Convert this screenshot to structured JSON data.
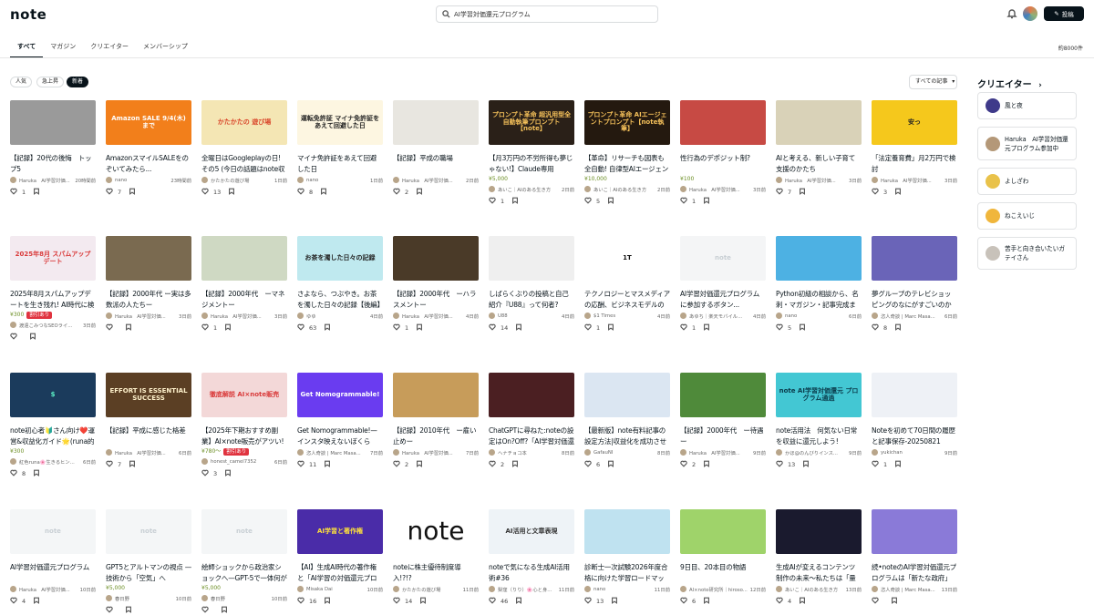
{
  "header": {
    "logo": "note",
    "search_value": "AI学習対価還元プログラム",
    "post_label": "投稿"
  },
  "tabs": [
    "すべて",
    "マガジン",
    "クリエイター",
    "メンバーシップ"
  ],
  "result_count": "約8000件",
  "filters": [
    "人気",
    "急上昇",
    "新着"
  ],
  "sort_label": "すべての記事",
  "sidebar": {
    "title": "クリエイター",
    "creators": [
      "風と夜",
      "Haruka　AI学習対価還元プログラム参加中",
      "よしざわ",
      "ねこえいじ",
      "苦手と向き合いたいガテイさん"
    ]
  },
  "cards": [
    {
      "thumb": "",
      "title": "【記録】20代の後悔　トップ5",
      "author": "Haruka　AI学習対価...",
      "time": "20時間前",
      "likes": "1"
    },
    {
      "thumb": "Amazon SALE 9/4(木)まで",
      "title": "AmazonスマイルSALEをのぞいてみたら...",
      "author": "nano",
      "time": "23時間前",
      "likes": "7"
    },
    {
      "thumb": "かたかたの 遊び場",
      "title": "全曜日はGoogleplayの日! その5 (今日の話題はnote収益化!)",
      "author": "かたかたの遊び場",
      "time": "1日前",
      "likes": "13"
    },
    {
      "thumb": "運転免許証 マイナ免許証を あえて回避した日",
      "title": "マイナ免許証をあえて回避した日",
      "author": "nano",
      "time": "1日前",
      "likes": "8"
    },
    {
      "thumb": "",
      "title": "【記録】平成の職場",
      "author": "Haruka　AI学習対価...",
      "time": "2日前",
      "likes": "2"
    },
    {
      "thumb": "プロンプト革命 超汎用型全自動執筆プロンプト【note】",
      "title": "【月3万円の不労所得も夢じゃない!】Claude専用(ChatGPTも対応)・NOTE...",
      "price": "¥5,000",
      "author": "あいこ｜AIのある生き方",
      "time": "2日前",
      "likes": "1"
    },
    {
      "thumb": "プロンプト革命 AIエージェントプロンプト【note執筆】",
      "title": "【革命】リサーチも図表も全自動! 自律型AIエージェントが30分で「月◯円稼ぐ...",
      "price": "¥10,000",
      "author": "あいこ｜AIのある生き方",
      "time": "2日前",
      "likes": "5"
    },
    {
      "thumb": "",
      "title": "性行為のデポジット制?",
      "price": "¥100",
      "author": "Haruka　AI学習対価...",
      "time": "3日前",
      "likes": "1"
    },
    {
      "thumb": "",
      "title": "AIと考える、新しい子育て支援のかたち",
      "author": "Haruka　AI学習対価...",
      "time": "3日前",
      "likes": "7"
    },
    {
      "thumb": "安っ",
      "title": "「法定養育費」月2万円で検討",
      "author": "Haruka　AI学習対価...",
      "time": "3日前",
      "likes": "3"
    },
    {
      "thumb": "2025年8月 スパムアップデート",
      "title": "2025年8月スパムアップデートを生き残れ! AI時代に検索上位になるnoteの条...",
      "price": "¥300",
      "badge": "割引あり",
      "author": "渡遠こみつなSEOライ...",
      "time": "3日前",
      "likes": ""
    },
    {
      "thumb": "",
      "title": "【記録】2000年代 ー実は多数派の人たちー",
      "author": "Haruka　AI学習対価...",
      "time": "3日前",
      "likes": ""
    },
    {
      "thumb": "",
      "title": "【記録】2000年代　ーマネジメントー",
      "author": "Haruka　AI学習対価...",
      "time": "3日前",
      "likes": "1"
    },
    {
      "thumb": "お茶を濁した日々の記録",
      "title": "さよなら、つぶやき。お茶を濁した日々の記録【後編】",
      "author": "ゆゆ",
      "time": "4日前",
      "likes": "63"
    },
    {
      "thumb": "",
      "title": "【記録】2000年代　ーハラスメントー",
      "author": "Haruka　AI学習対価...",
      "time": "4日前",
      "likes": "1"
    },
    {
      "thumb": "",
      "title": "しばらくぶりの投稿と自己紹介『U88』って何者?",
      "author": "U88",
      "time": "4日前",
      "likes": "14"
    },
    {
      "thumb": "1T",
      "title": "テクノロジーとマスメディアの応酬、ビジネスモデルの変革が鍵",
      "author": "$1 Times",
      "time": "4日前",
      "likes": "1"
    },
    {
      "thumb": "note",
      "title": "AI学習対価還元プログラムに参加するボタン...",
      "author": "あゆち｜楽天モバイル...",
      "time": "4日前",
      "likes": "1"
    },
    {
      "thumb": "",
      "title": "Python初級の相談から、名刺・マガジン・記事完成まで!?生成AIと走る「脱線...",
      "author": "nano",
      "time": "6日前",
      "likes": "5"
    },
    {
      "thumb": "",
      "title": "夢グループのテレビショッピングのなにがすごいのか—ノモグラムとレッシグ四...",
      "author": "恣人奇談 | Marc Masa...",
      "time": "6日前",
      "likes": "8"
    },
    {
      "thumb": "$",
      "title": "note初心者🔰さん向け❤️運営&収益化ガイド🌟(runa的秘訣シェア🤗)",
      "price": "¥300",
      "author": "紅色runa🌸生きるヒン...",
      "time": "6日前",
      "likes": "8"
    },
    {
      "thumb": "EFFORT IS ESSENTIAL SUCCESS",
      "title": "【記録】平成に感じた格差",
      "author": "Haruka　AI学習対価...",
      "time": "6日前",
      "likes": "7"
    },
    {
      "thumb": "徹底解説 AI×note販売",
      "title": "【2025年下期おすすめ副業】AI×note販売がアツい! 今から始めて先行者利益...",
      "price": "¥780〜",
      "badge": "割引あり",
      "author": "honest_camel7352",
      "time": "6日前",
      "likes": "3"
    },
    {
      "thumb": "Get Nomogrammable!",
      "title": "Get Nomogrammable!—インスタ映えないぼくらが、世界初のノモグラ映え建...",
      "author": "恣人奇談 | Marc Masa...",
      "time": "7日前",
      "likes": "11"
    },
    {
      "thumb": "",
      "title": "【記録】2010年代　ー雇い止めー",
      "author": "Haruka　AI学習対価...",
      "time": "7日前",
      "likes": "2"
    },
    {
      "thumb": "",
      "title": "ChatGPTに尋ねた:noteの設定はOn?Off?「AI学習対価還元プログラム」",
      "author": "ヘナチョコ本",
      "time": "8日前",
      "likes": "2"
    },
    {
      "thumb": "",
      "title": "【最新版】note有料記事の設定方法|収益化を成功させる5つのポイント",
      "author": "GafauNI",
      "time": "8日前",
      "likes": "6"
    },
    {
      "thumb": "",
      "title": "【記録】2000年代　ー待遇ー",
      "author": "Haruka　AI学習対価...",
      "time": "9日前",
      "likes": "2"
    },
    {
      "thumb": "note AI学習対価還元 プログラム通過",
      "title": "note活用法　何気ない日常を収益に還元しよう!",
      "author": "かほ@のんびりインス...",
      "time": "9日前",
      "likes": "13"
    },
    {
      "thumb": "",
      "title": "Noteを初めて70日間の履歴と記事保存-20250821",
      "author": "yukichan",
      "time": "9日前",
      "likes": "1"
    },
    {
      "thumb": "note",
      "title": "AI学習対価還元プログラム",
      "author": "Haruka　AI学習対価...",
      "time": "10日前",
      "likes": "4"
    },
    {
      "thumb": "note",
      "title": "GPT5とアルトマンの視点 — 技術から「空気」へ",
      "price": "¥5,000",
      "author": "春日野",
      "time": "10日前",
      "likes": ""
    },
    {
      "thumb": "note",
      "title": "絵師ショックから政治家ショックへ—GPT-5で一体何が変わったのか",
      "price": "¥5,000",
      "author": "春日野",
      "time": "10日前",
      "likes": ""
    },
    {
      "thumb": "AI学習と著作権",
      "title": "【AI】生成AI時代の著作権と「AI学習の対価還元プログラム」の社会的意義",
      "author": "Misaka Dai",
      "time": "10日前",
      "likes": "16"
    },
    {
      "thumb": "note",
      "title": "noteに株主優待制度導入!?!?",
      "author": "かたかたの遊び場",
      "time": "11日前",
      "likes": "14"
    },
    {
      "thumb": "AI活用と文章表現",
      "title": "noteで気になる生成AI活用術#36",
      "author": "梨窪（りり）🌸心と身...",
      "time": "11日前",
      "likes": "46"
    },
    {
      "thumb": "",
      "title": "診断士一次試験2026年度合格に向けた学習ロードマップと生成AI活用計画",
      "author": "nano",
      "time": "11日前",
      "likes": "13"
    },
    {
      "thumb": "",
      "title": "9日目、20本目の物語",
      "author": "AI×note研究所｜hiroso...",
      "time": "12日前",
      "likes": "6"
    },
    {
      "thumb": "",
      "title": "生成AIが変えるコンテンツ制作の未来〜私たちは「量産型」になってしまうのか...",
      "author": "あいこ｜AIのある生き方",
      "time": "13日前",
      "likes": "4"
    },
    {
      "thumb": "",
      "title": "続•noteのAI学習対価還元プログラムは「新たな政府」の誕生である—ノモグラ...",
      "author": "恣人奇談 | Marc Masa...",
      "time": "13日前",
      "likes": ""
    }
  ]
}
